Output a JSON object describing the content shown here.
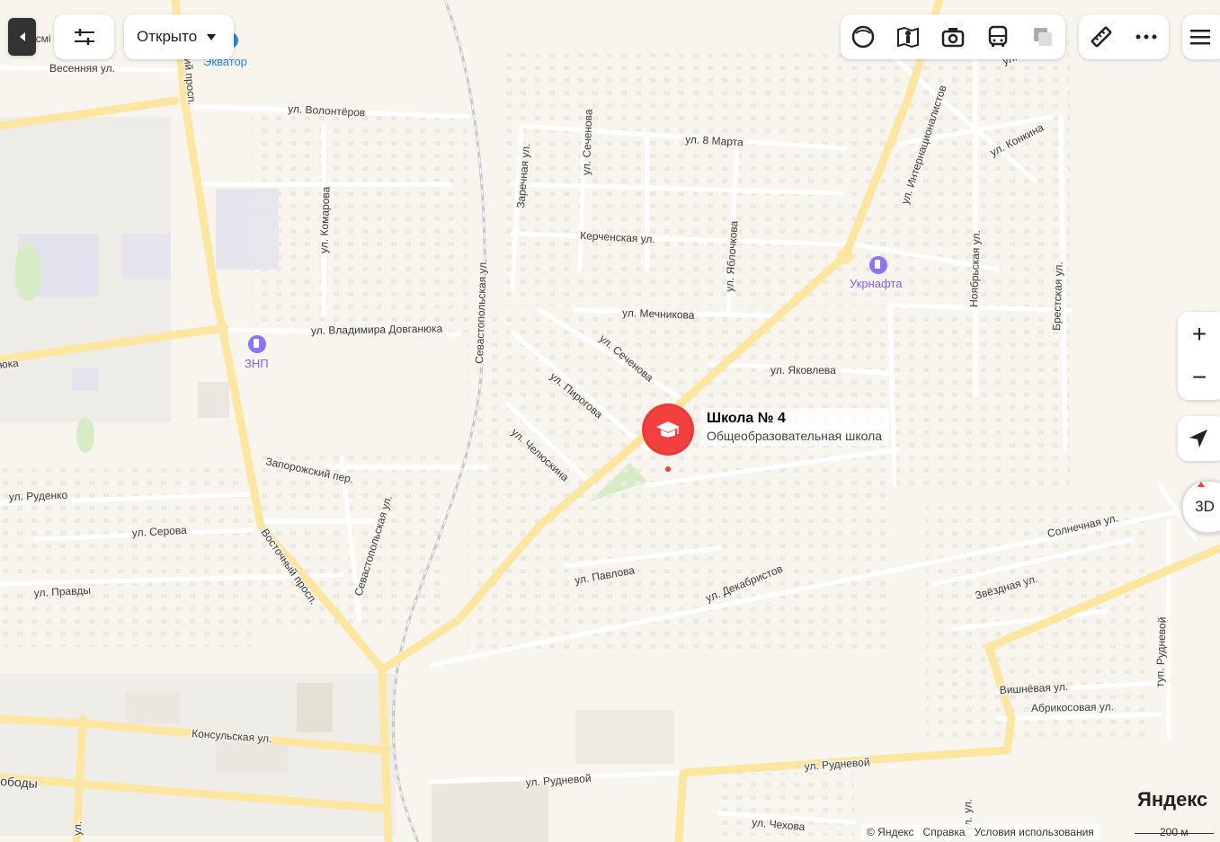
{
  "toolbar": {
    "filter_dropdown": "Открыто"
  },
  "zoom": {
    "in": "+",
    "out": "−"
  },
  "view_3d": "3D",
  "marker": {
    "title": "Школа № 4",
    "subtitle": "Общеобразовательная школа",
    "color": "#f43f3f"
  },
  "pois": [
    {
      "name": "Экватор",
      "kind": "gas-station"
    },
    {
      "name": "ЗНП",
      "kind": "gas-station"
    },
    {
      "name": "Укрнафта",
      "kind": "gas-station"
    }
  ],
  "streets": {
    "vesennyaya": "Весенняя ул.",
    "volonterov": "ул. Волонтёров",
    "zarechnaya": "Заречная ул.",
    "sechenova_n": "ул. Сеченова",
    "march8": "ул. 8 Марта",
    "konkina": "ул. Конкина",
    "internatsionalistov": "ул. Интернационалистов",
    "kerchenskaya": "Керченская ул.",
    "yablochkova": "ул. Яблочкова",
    "noyabrskaya": "Ноябрьская ул.",
    "brestskaya": "Брестская ул.",
    "komarova": "ул. Комарова",
    "sevastopolskaya_n": "Севастопольская ул.",
    "mechnikova": "ул. Мечникова",
    "dovganyuka": "ул. Владимира Довганюка",
    "dovganyuka_w": "юка",
    "sechenova_s": "ул. Сеченова",
    "yakovleva": "ул. Яковлева",
    "pirogova": "ул. Пирогова",
    "chelyuskina": "ул. Челюскина",
    "zaporozhsky": "Запорожский пер.",
    "rudenko": "ул. Руденко",
    "serova": "ул. Серова",
    "pravdy": "ул. Правды",
    "vostochny": "Восточный просп.",
    "vostochny_n": "ий просп.",
    "sevastopolskaya_s": "Севастопольская ул.",
    "pavlova": "ул. Павлова",
    "dekabristov": "ул. Декабристов",
    "solnechnaya": "Солнечная ул.",
    "zvezdnaya": "Звёздная ул.",
    "vishnevaya": "Вишнёвая ул.",
    "abrikosovaya": "Абрикосовая ул.",
    "rudnevoy_lane": "туп. Рудневой",
    "konsulskaya": "Консульская ул.",
    "rudnevoy": "ул. Рудневой",
    "rudnevoy2": "ул. Рудневой",
    "svobody": "ободы",
    "chekhova": "ул. Чехова",
    "partial_cm": "ісмі",
    "partial_ul": "ул.",
    "partial_ul2": "ул.",
    "partial_ul3": "ул.",
    "partial_ya": "я ул."
  },
  "footer": {
    "copyright": "© Яндекс",
    "help": "Справка",
    "terms": "Условия использования",
    "scale": "200 м"
  },
  "logo": "Яндекс",
  "colors": {
    "map_bg": "#f7f5ee",
    "main_road": "#fde6a0",
    "minor_road": "#ffffff",
    "poi": "#7b61ff",
    "marker": "#f43f3f"
  }
}
